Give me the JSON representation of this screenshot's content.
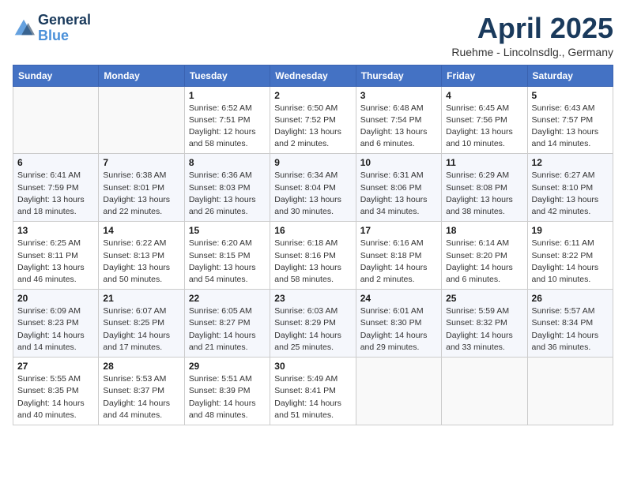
{
  "header": {
    "logo_line1": "General",
    "logo_line2": "Blue",
    "month_title": "April 2025",
    "subtitle": "Ruehme - Lincolnsdlg., Germany"
  },
  "weekdays": [
    "Sunday",
    "Monday",
    "Tuesday",
    "Wednesday",
    "Thursday",
    "Friday",
    "Saturday"
  ],
  "weeks": [
    [
      {
        "day": "",
        "info": ""
      },
      {
        "day": "",
        "info": ""
      },
      {
        "day": "1",
        "info": "Sunrise: 6:52 AM\nSunset: 7:51 PM\nDaylight: 12 hours\nand 58 minutes."
      },
      {
        "day": "2",
        "info": "Sunrise: 6:50 AM\nSunset: 7:52 PM\nDaylight: 13 hours\nand 2 minutes."
      },
      {
        "day": "3",
        "info": "Sunrise: 6:48 AM\nSunset: 7:54 PM\nDaylight: 13 hours\nand 6 minutes."
      },
      {
        "day": "4",
        "info": "Sunrise: 6:45 AM\nSunset: 7:56 PM\nDaylight: 13 hours\nand 10 minutes."
      },
      {
        "day": "5",
        "info": "Sunrise: 6:43 AM\nSunset: 7:57 PM\nDaylight: 13 hours\nand 14 minutes."
      }
    ],
    [
      {
        "day": "6",
        "info": "Sunrise: 6:41 AM\nSunset: 7:59 PM\nDaylight: 13 hours\nand 18 minutes."
      },
      {
        "day": "7",
        "info": "Sunrise: 6:38 AM\nSunset: 8:01 PM\nDaylight: 13 hours\nand 22 minutes."
      },
      {
        "day": "8",
        "info": "Sunrise: 6:36 AM\nSunset: 8:03 PM\nDaylight: 13 hours\nand 26 minutes."
      },
      {
        "day": "9",
        "info": "Sunrise: 6:34 AM\nSunset: 8:04 PM\nDaylight: 13 hours\nand 30 minutes."
      },
      {
        "day": "10",
        "info": "Sunrise: 6:31 AM\nSunset: 8:06 PM\nDaylight: 13 hours\nand 34 minutes."
      },
      {
        "day": "11",
        "info": "Sunrise: 6:29 AM\nSunset: 8:08 PM\nDaylight: 13 hours\nand 38 minutes."
      },
      {
        "day": "12",
        "info": "Sunrise: 6:27 AM\nSunset: 8:10 PM\nDaylight: 13 hours\nand 42 minutes."
      }
    ],
    [
      {
        "day": "13",
        "info": "Sunrise: 6:25 AM\nSunset: 8:11 PM\nDaylight: 13 hours\nand 46 minutes."
      },
      {
        "day": "14",
        "info": "Sunrise: 6:22 AM\nSunset: 8:13 PM\nDaylight: 13 hours\nand 50 minutes."
      },
      {
        "day": "15",
        "info": "Sunrise: 6:20 AM\nSunset: 8:15 PM\nDaylight: 13 hours\nand 54 minutes."
      },
      {
        "day": "16",
        "info": "Sunrise: 6:18 AM\nSunset: 8:16 PM\nDaylight: 13 hours\nand 58 minutes."
      },
      {
        "day": "17",
        "info": "Sunrise: 6:16 AM\nSunset: 8:18 PM\nDaylight: 14 hours\nand 2 minutes."
      },
      {
        "day": "18",
        "info": "Sunrise: 6:14 AM\nSunset: 8:20 PM\nDaylight: 14 hours\nand 6 minutes."
      },
      {
        "day": "19",
        "info": "Sunrise: 6:11 AM\nSunset: 8:22 PM\nDaylight: 14 hours\nand 10 minutes."
      }
    ],
    [
      {
        "day": "20",
        "info": "Sunrise: 6:09 AM\nSunset: 8:23 PM\nDaylight: 14 hours\nand 14 minutes."
      },
      {
        "day": "21",
        "info": "Sunrise: 6:07 AM\nSunset: 8:25 PM\nDaylight: 14 hours\nand 17 minutes."
      },
      {
        "day": "22",
        "info": "Sunrise: 6:05 AM\nSunset: 8:27 PM\nDaylight: 14 hours\nand 21 minutes."
      },
      {
        "day": "23",
        "info": "Sunrise: 6:03 AM\nSunset: 8:29 PM\nDaylight: 14 hours\nand 25 minutes."
      },
      {
        "day": "24",
        "info": "Sunrise: 6:01 AM\nSunset: 8:30 PM\nDaylight: 14 hours\nand 29 minutes."
      },
      {
        "day": "25",
        "info": "Sunrise: 5:59 AM\nSunset: 8:32 PM\nDaylight: 14 hours\nand 33 minutes."
      },
      {
        "day": "26",
        "info": "Sunrise: 5:57 AM\nSunset: 8:34 PM\nDaylight: 14 hours\nand 36 minutes."
      }
    ],
    [
      {
        "day": "27",
        "info": "Sunrise: 5:55 AM\nSunset: 8:35 PM\nDaylight: 14 hours\nand 40 minutes."
      },
      {
        "day": "28",
        "info": "Sunrise: 5:53 AM\nSunset: 8:37 PM\nDaylight: 14 hours\nand 44 minutes."
      },
      {
        "day": "29",
        "info": "Sunrise: 5:51 AM\nSunset: 8:39 PM\nDaylight: 14 hours\nand 48 minutes."
      },
      {
        "day": "30",
        "info": "Sunrise: 5:49 AM\nSunset: 8:41 PM\nDaylight: 14 hours\nand 51 minutes."
      },
      {
        "day": "",
        "info": ""
      },
      {
        "day": "",
        "info": ""
      },
      {
        "day": "",
        "info": ""
      }
    ]
  ]
}
